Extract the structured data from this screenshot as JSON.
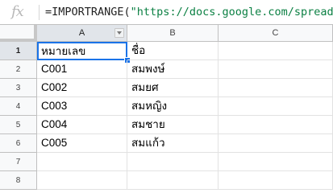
{
  "formula_bar": {
    "icon": "fx-icon",
    "fx_label": "fx",
    "formula_prefix": "=IMPORTRANGE(",
    "formula_string": "\"https://docs.google.com/spreadsheets"
  },
  "columns": [
    "A",
    "B",
    "C"
  ],
  "rows": [
    "1",
    "2",
    "3",
    "4",
    "5",
    "6",
    "7",
    "8"
  ],
  "cells": [
    [
      "หมายเลข",
      "ชื่อ",
      ""
    ],
    [
      "C001",
      "สมพงษ์",
      ""
    ],
    [
      "C002",
      "สมยศ",
      ""
    ],
    [
      "C003",
      "สมหญิง",
      ""
    ],
    [
      "C004",
      "สมชาย",
      ""
    ],
    [
      "C005",
      "สมแก้ว",
      ""
    ],
    [
      "",
      "",
      ""
    ],
    [
      "",
      "",
      ""
    ]
  ],
  "colors": {
    "selection": "#1a73e8",
    "formula_string": "#0b8043",
    "header_bg": "#f8f9fa",
    "active_header_bg": "#e1e5ea"
  }
}
